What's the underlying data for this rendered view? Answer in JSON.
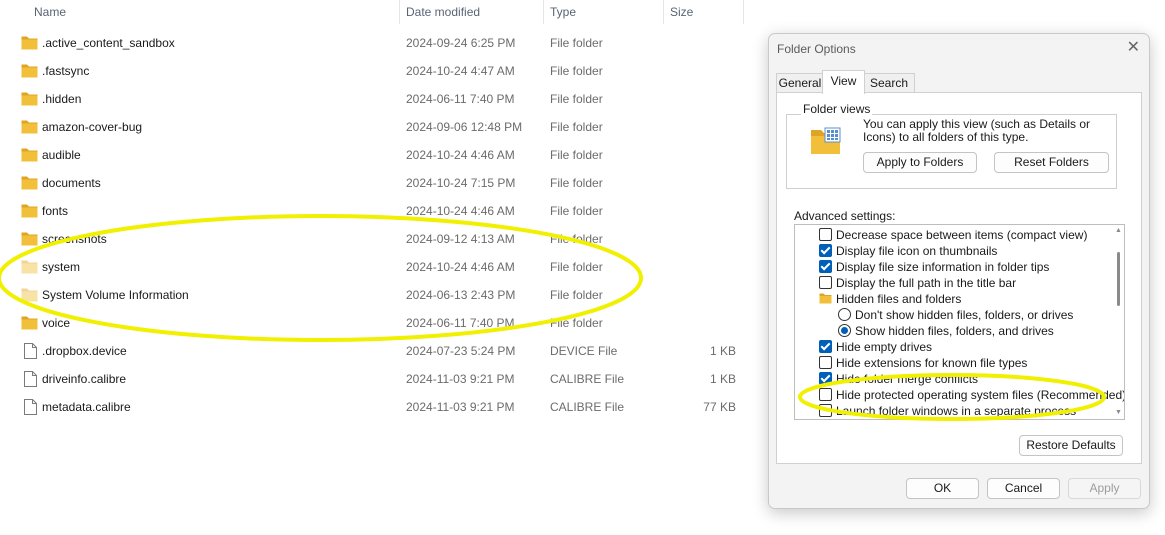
{
  "explorer": {
    "columns": {
      "name": "Name",
      "date": "Date modified",
      "type": "Type",
      "size": "Size"
    },
    "sort_glyph": "^",
    "files": [
      {
        "name": ".active_content_sandbox",
        "date": "2024-09-24 6:25 PM",
        "type": "File folder",
        "size": "",
        "kind": "folder",
        "faded": false
      },
      {
        "name": ".fastsync",
        "date": "2024-10-24 4:47 AM",
        "type": "File folder",
        "size": "",
        "kind": "folder",
        "faded": false
      },
      {
        "name": ".hidden",
        "date": "2024-06-11 7:40 PM",
        "type": "File folder",
        "size": "",
        "kind": "folder",
        "faded": false
      },
      {
        "name": "amazon-cover-bug",
        "date": "2024-09-06 12:48 PM",
        "type": "File folder",
        "size": "",
        "kind": "folder",
        "faded": false
      },
      {
        "name": "audible",
        "date": "2024-10-24 4:46 AM",
        "type": "File folder",
        "size": "",
        "kind": "folder",
        "faded": false
      },
      {
        "name": "documents",
        "date": "2024-10-24 7:15 PM",
        "type": "File folder",
        "size": "",
        "kind": "folder",
        "faded": false
      },
      {
        "name": "fonts",
        "date": "2024-10-24 4:46 AM",
        "type": "File folder",
        "size": "",
        "kind": "folder",
        "faded": false
      },
      {
        "name": "screenshots",
        "date": "2024-09-12 4:13 AM",
        "type": "File folder",
        "size": "",
        "kind": "folder",
        "faded": false
      },
      {
        "name": "system",
        "date": "2024-10-24 4:46 AM",
        "type": "File folder",
        "size": "",
        "kind": "folder",
        "faded": true
      },
      {
        "name": "System Volume Information",
        "date": "2024-06-13 2:43 PM",
        "type": "File folder",
        "size": "",
        "kind": "folder",
        "faded": true
      },
      {
        "name": "voice",
        "date": "2024-06-11 7:40 PM",
        "type": "File folder",
        "size": "",
        "kind": "folder",
        "faded": false
      },
      {
        "name": ".dropbox.device",
        "date": "2024-07-23 5:24 PM",
        "type": "DEVICE File",
        "size": "1 KB",
        "kind": "file",
        "faded": false
      },
      {
        "name": "driveinfo.calibre",
        "date": "2024-11-03 9:21 PM",
        "type": "CALIBRE File",
        "size": "1 KB",
        "kind": "file",
        "faded": false
      },
      {
        "name": "metadata.calibre",
        "date": "2024-11-03 9:21 PM",
        "type": "CALIBRE File",
        "size": "77 KB",
        "kind": "file",
        "faded": false
      }
    ]
  },
  "dialog": {
    "title": "Folder Options",
    "close_glyph": "✕",
    "tabs": [
      "General",
      "View",
      "Search"
    ],
    "active_tab": "View",
    "folder_views": {
      "label": "Folder views",
      "text": "You can apply this view (such as Details or Icons) to all folders of this type.",
      "apply_button": "Apply to Folders",
      "reset_button": "Reset Folders"
    },
    "advanced_label": "Advanced settings:",
    "advanced_items": [
      {
        "label": "Decrease space between items (compact view)",
        "control": "checkbox",
        "checked": false,
        "indent": 0
      },
      {
        "label": "Display file icon on thumbnails",
        "control": "checkbox",
        "checked": true,
        "indent": 0
      },
      {
        "label": "Display file size information in folder tips",
        "control": "checkbox",
        "checked": true,
        "indent": 0
      },
      {
        "label": "Display the full path in the title bar",
        "control": "checkbox",
        "checked": false,
        "indent": 0
      },
      {
        "label": "Hidden files and folders",
        "control": "folder",
        "checked": false,
        "indent": 0
      },
      {
        "label": "Don't show hidden files, folders, or drives",
        "control": "radio",
        "checked": false,
        "indent": 1
      },
      {
        "label": "Show hidden files, folders, and drives",
        "control": "radio",
        "checked": true,
        "indent": 1
      },
      {
        "label": "Hide empty drives",
        "control": "checkbox",
        "checked": true,
        "indent": 0
      },
      {
        "label": "Hide extensions for known file types",
        "control": "checkbox",
        "checked": false,
        "indent": 0
      },
      {
        "label": "Hide folder merge conflicts",
        "control": "checkbox",
        "checked": true,
        "indent": 0
      },
      {
        "label": "Hide protected operating system files (Recommended)",
        "control": "checkbox",
        "checked": false,
        "indent": 0
      },
      {
        "label": "Launch folder windows in a separate process",
        "control": "checkbox",
        "checked": false,
        "indent": 0
      }
    ],
    "scroll_up_glyph": "▲",
    "scroll_down_glyph": "▼",
    "restore_button": "Restore Defaults",
    "ok_button": "OK",
    "cancel_button": "Cancel",
    "apply_button": "Apply"
  },
  "annotations": {
    "color": "#f0f000"
  },
  "colors": {
    "folder": "#f2bf3a",
    "folder_dark": "#e0a424",
    "checked": "#005fb8"
  }
}
